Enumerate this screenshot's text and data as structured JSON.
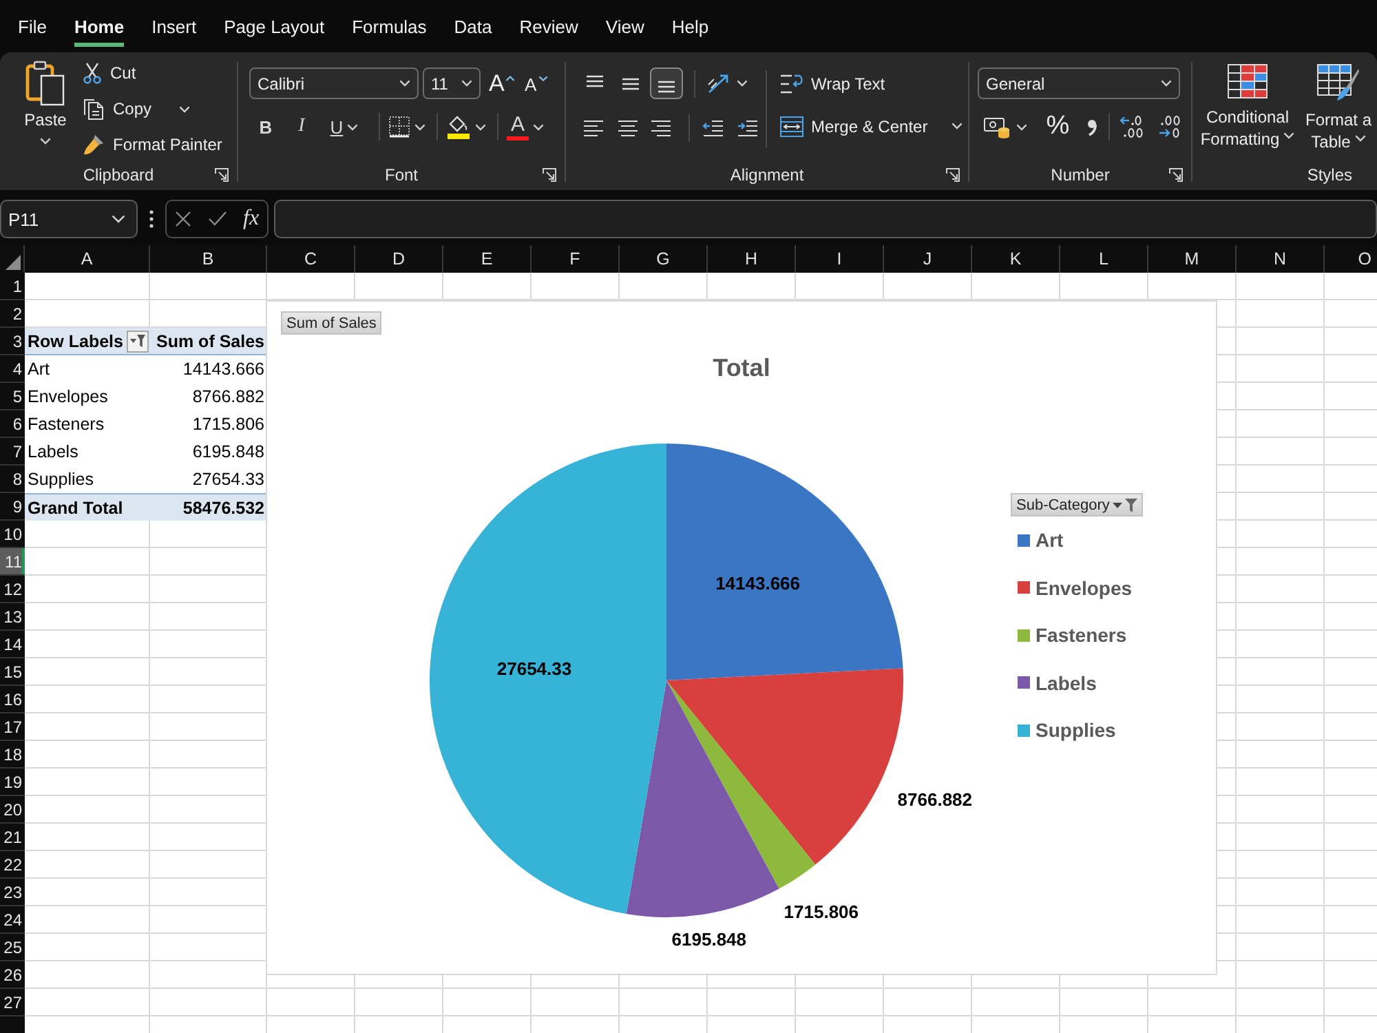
{
  "menu_tabs": [
    {
      "label": "File",
      "selected": false
    },
    {
      "label": "Home",
      "selected": true
    },
    {
      "label": "Insert",
      "selected": false
    },
    {
      "label": "Page Layout",
      "selected": false
    },
    {
      "label": "Formulas",
      "selected": false
    },
    {
      "label": "Data",
      "selected": false
    },
    {
      "label": "Review",
      "selected": false
    },
    {
      "label": "View",
      "selected": false
    },
    {
      "label": "Help",
      "selected": false
    }
  ],
  "ribbon": {
    "clipboard": {
      "label": "Clipboard",
      "paste": "Paste",
      "cut": "Cut",
      "copy": "Copy",
      "format_painter": "Format Painter"
    },
    "font": {
      "label": "Font",
      "font_name": "Calibri",
      "font_size": "11",
      "grow_font": "A",
      "shrink_font": "A",
      "bold": "B",
      "italic": "I",
      "underline": "U",
      "font_color": "A"
    },
    "alignment": {
      "label": "Alignment",
      "vertical": [
        {
          "kind": "top",
          "selected": false
        },
        {
          "kind": "middle",
          "selected": false
        },
        {
          "kind": "bottom",
          "selected": true
        }
      ],
      "horizontal": [
        {
          "kind": "left",
          "selected": false
        },
        {
          "kind": "center",
          "selected": false
        },
        {
          "kind": "right",
          "selected": false
        }
      ],
      "wrap_text": "Wrap Text",
      "merge_center": "Merge & Center"
    },
    "number": {
      "label": "Number",
      "format": "General",
      "percent": "%"
    },
    "styles": {
      "label": "Styles",
      "buttons": [
        {
          "kind": "conditional_formatting",
          "lines": [
            "Conditional",
            "Formatting"
          ]
        },
        {
          "kind": "format_as_table",
          "lines": [
            "Format a",
            "Table"
          ]
        }
      ]
    }
  },
  "formula_bar": {
    "name_box": "P11",
    "function_label": "fx"
  },
  "sheet": {
    "columns": [
      "A",
      "B",
      "C",
      "D",
      "E",
      "F",
      "G",
      "H",
      "I",
      "J",
      "K",
      "L",
      "M",
      "N",
      "O"
    ],
    "rows": [
      {
        "label": "1",
        "selected": false
      },
      {
        "label": "2",
        "selected": false
      },
      {
        "label": "3",
        "selected": false
      },
      {
        "label": "4",
        "selected": false
      },
      {
        "label": "5",
        "selected": false
      },
      {
        "label": "6",
        "selected": false
      },
      {
        "label": "7",
        "selected": false
      },
      {
        "label": "8",
        "selected": false
      },
      {
        "label": "9",
        "selected": false
      },
      {
        "label": "10",
        "selected": false
      },
      {
        "label": "11",
        "selected": true
      },
      {
        "label": "12",
        "selected": false
      },
      {
        "label": "13",
        "selected": false
      },
      {
        "label": "14",
        "selected": false
      },
      {
        "label": "15",
        "selected": false
      },
      {
        "label": "16",
        "selected": false
      },
      {
        "label": "17",
        "selected": false
      },
      {
        "label": "18",
        "selected": false
      },
      {
        "label": "19",
        "selected": false
      },
      {
        "label": "20",
        "selected": false
      },
      {
        "label": "21",
        "selected": false
      },
      {
        "label": "22",
        "selected": false
      },
      {
        "label": "23",
        "selected": false
      },
      {
        "label": "24",
        "selected": false
      },
      {
        "label": "25",
        "selected": false
      },
      {
        "label": "26",
        "selected": false
      },
      {
        "label": "27",
        "selected": false
      }
    ],
    "pivot": {
      "headers": [
        "Row Labels",
        "Sum of Sales"
      ],
      "rows": [
        {
          "label": "Art",
          "value": "14143.666"
        },
        {
          "label": "Envelopes",
          "value": "8766.882"
        },
        {
          "label": "Fasteners",
          "value": "1715.806"
        },
        {
          "label": "Labels",
          "value": "6195.848"
        },
        {
          "label": "Supplies",
          "value": "27654.33"
        }
      ],
      "total": {
        "label": "Grand Total",
        "value": "58476.532"
      }
    }
  },
  "chart": {
    "field_button": "Sum of Sales",
    "legend_field": "Sub-Category",
    "chart_data": [
      {
        "type": "pie",
        "title": "Total",
        "categories": [
          "Art",
          "Envelopes",
          "Fasteners",
          "Labels",
          "Supplies"
        ],
        "values": [
          14143.666,
          8766.882,
          1715.806,
          6195.848,
          27654.33
        ],
        "colors": [
          "#3a76c4",
          "#d8403d",
          "#8dba3c",
          "#7b58a8",
          "#36b3d6"
        ],
        "data_labels": true,
        "value_labels": [
          "14143.666",
          "8766.882",
          "1715.806",
          "6195.848",
          "27654.33"
        ],
        "legend": "right"
      }
    ]
  }
}
